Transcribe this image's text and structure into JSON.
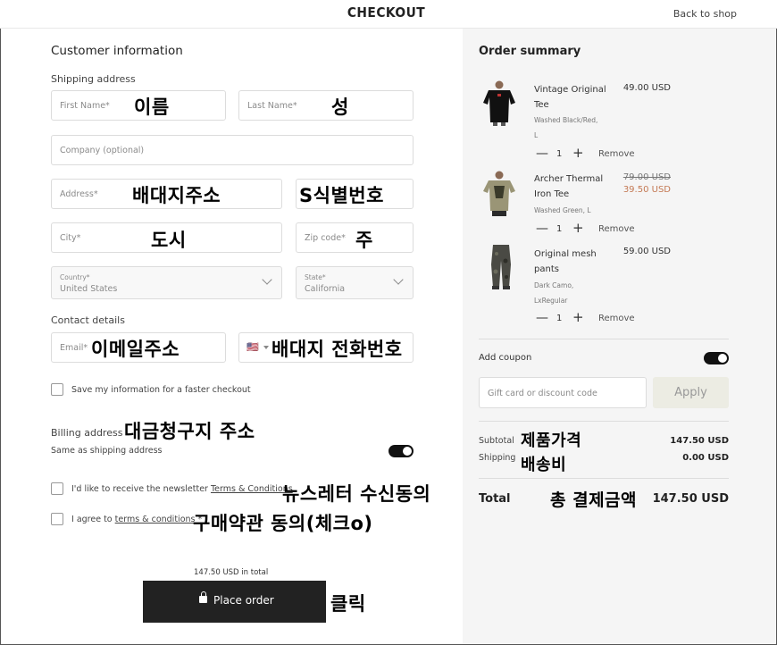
{
  "header": {
    "logo": "CHECKOUT",
    "back_link": "Back to shop"
  },
  "customer": {
    "title": "Customer information",
    "shipping_label": "Shipping address",
    "first_name": {
      "placeholder": "First Name*",
      "note": "이름"
    },
    "last_name": {
      "placeholder": "Last Name*",
      "note": "성"
    },
    "company": {
      "placeholder": "Company (optional)"
    },
    "address": {
      "placeholder": "Address*",
      "note": "배대지주소"
    },
    "address2": {
      "placeholder": "",
      "note": "S식별번호"
    },
    "city": {
      "placeholder": "City*",
      "note": "도시"
    },
    "zip": {
      "placeholder": "Zip code*",
      "note": "주"
    },
    "country": {
      "label": "Country*",
      "value": "United States"
    },
    "state": {
      "label": "State*",
      "value": "California"
    },
    "contact_label": "Contact details",
    "email": {
      "placeholder": "Email*",
      "note": "이메일주소"
    },
    "phone": {
      "flag": "🇺🇸",
      "note": "배대지 전화번호"
    },
    "save_info": "Save my information for a faster checkout",
    "billing_label": "Billing address",
    "billing_note": "대금청구지 주소",
    "same_as_shipping": "Same as shipping address",
    "newsletter_prefix": "I'd like to receive the newsletter ",
    "newsletter_link": "Terms & Conditions",
    "newsletter_note": "뉴스레터 수신동의",
    "agree_prefix": "I agree to ",
    "agree_link": "terms & conditions",
    "agree_suffix": " *",
    "agree_note": "구매약관 동의(체크o)",
    "order_total_text": "147.50 USD in total",
    "place_order": "Place order",
    "click_note": "클릭"
  },
  "summary": {
    "title": "Order summary",
    "items": [
      {
        "name_line1": "Vintage Original",
        "name_line2": "Tee",
        "variant_line1": "Washed Black/Red,",
        "variant_line2": "L",
        "price": "49.00 USD",
        "qty": "1",
        "remove": "Remove"
      },
      {
        "name_line1": "Archer Thermal",
        "name_line2": "Iron Tee",
        "variant_line1": "Washed Green,  L",
        "old_price": "79.00 USD",
        "price": "39.50 USD",
        "qty": "1",
        "remove": "Remove"
      },
      {
        "name_line1": "Original mesh",
        "name_line2": "pants",
        "variant_line1": "Dark Camo,",
        "variant_line2": "LxRegular",
        "price": "59.00 USD",
        "qty": "1",
        "remove": "Remove"
      }
    ],
    "coupon_label": "Add coupon",
    "coupon_placeholder": "Gift card or discount code",
    "apply": "Apply",
    "subtotal_label": "Subtotal",
    "subtotal_note": "제품가격",
    "subtotal_value": "147.50 USD",
    "shipping_label": "Shipping",
    "shipping_note": "배송비",
    "shipping_value": "0.00 USD",
    "total_label": "Total",
    "total_note": "총 결제금액",
    "total_value": "147.50 USD"
  },
  "colors": {
    "accent": "#222222",
    "sale": "#c47a55",
    "panel_bg": "#f5f5f5"
  }
}
